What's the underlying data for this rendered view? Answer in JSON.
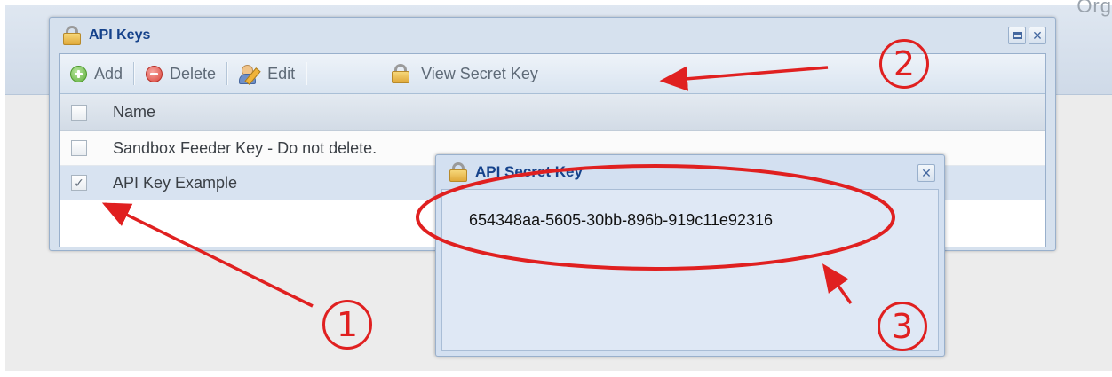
{
  "app": {
    "org_label": "Org"
  },
  "api_keys_window": {
    "title": "API Keys",
    "title_icon": "lock-icon",
    "window_buttons": [
      "maximize-icon",
      "close-icon"
    ],
    "toolbar": {
      "add_label": "Add",
      "delete_label": "Delete",
      "edit_label": "Edit",
      "view_secret_label": "View Secret Key"
    },
    "grid": {
      "header": "Name",
      "rows": [
        {
          "name": "Sandbox Feeder Key - Do not delete.",
          "checked": false
        },
        {
          "name": "API Key Example",
          "checked": true
        }
      ]
    }
  },
  "secret_popup": {
    "title": "API Secret Key",
    "secret_value": "654348aa-5605-30bb-896b-919c11e92316"
  },
  "annotations": {
    "markers": [
      "1",
      "2",
      "3"
    ],
    "color": "#e02020"
  },
  "colors": {
    "title_text": "#15428b",
    "selected_row": "#d8e3f1",
    "annotation": "#e02020"
  }
}
